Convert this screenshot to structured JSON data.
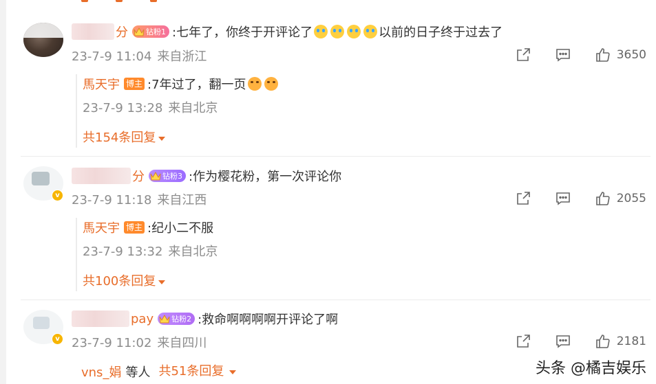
{
  "comments": [
    {
      "username_visible": "分",
      "fan_badge": "钻粉1",
      "text_before": ":七年了，你终于开评论了",
      "emojis": 4,
      "text_after": "以前的日子终于过去了",
      "date": "23-7-9 11:04",
      "source": "来自浙江",
      "likes": "3650",
      "reply": {
        "name": "馬天宇",
        "badge": "博主",
        "text": ":7年过了，翻一页",
        "date": "23-7-9 13:28",
        "source": "来自北京"
      },
      "more": "共154条回复"
    },
    {
      "username_visible": "分",
      "fan_badge": "钻粉3",
      "text": ":作为樱花粉，第一次评论你",
      "date": "23-7-9 11:18",
      "source": "来自江西",
      "likes": "2055",
      "reply": {
        "name": "馬天宇",
        "badge": "博主",
        "text": ":纪小二不服",
        "date": "23-7-9 13:32",
        "source": "来自北京"
      },
      "more": "共100条回复"
    },
    {
      "username_visible": "pay",
      "fan_badge": "钻粉2",
      "text": ":救命啊啊啊啊开评论了啊",
      "date": "23-7-9 11:02",
      "source": "来自四川",
      "likes": "2181",
      "replies_users": "vns_娟",
      "replies_etc": "等人",
      "more": "共51条回复"
    }
  ],
  "watermark": "头条 @橘吉娱乐",
  "icons": {
    "share": "share-icon",
    "comment": "comment-icon",
    "like": "thumb-up-icon",
    "verified": "v-badge-icon"
  },
  "colors": {
    "accent": "#e86d2a",
    "meta": "#8c8c8c",
    "host_badge": "#ff8a2c",
    "verified": "#f7b500"
  }
}
